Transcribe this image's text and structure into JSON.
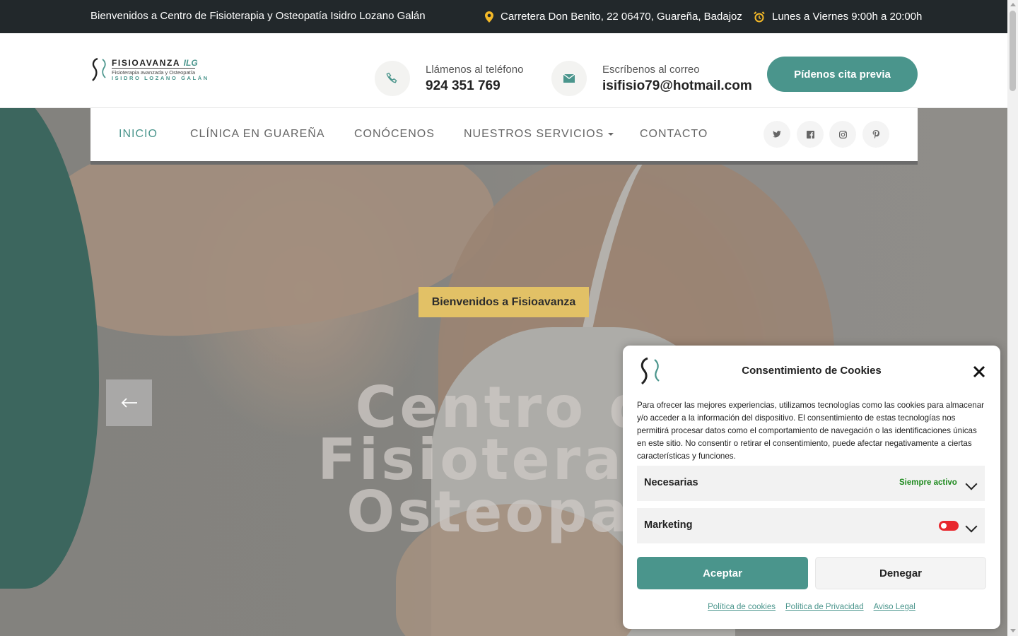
{
  "topbar": {
    "welcome": "Bienvenidos a Centro de Fisioterapia y Osteopatía Isidro Lozano Galán",
    "address": "Carretera Don Benito, 22 06470, Guareña, Badajoz",
    "hours": "Lunes a Viernes 9:00h a 20:00h",
    "icons": [
      "map-pin-icon",
      "alarm-clock-icon"
    ]
  },
  "header": {
    "logo": {
      "brand": "FISIOAVANZA",
      "brand_accent": "ILG",
      "tagline": "Fisioterapia avanzada y Osteopatía",
      "owner": "ISIDRO LOZANO GALÁN"
    },
    "phone": {
      "label": "Llámenos al teléfono",
      "value": "924 351 769"
    },
    "email": {
      "label": "Escríbenos al correo",
      "value": "isifisio79@hotmail.com"
    },
    "cta_label": "Pídenos cita previa"
  },
  "nav": {
    "items": [
      {
        "label": "INICIO",
        "active": true
      },
      {
        "label": "CLÍNICA EN GUAREÑA",
        "active": false
      },
      {
        "label": "CONÓCENOS",
        "active": false
      },
      {
        "label": "NUESTROS SERVICIOS",
        "active": false,
        "dropdown": true
      },
      {
        "label": "CONTACTO",
        "active": false
      }
    ],
    "social": [
      "twitter-icon",
      "facebook-icon",
      "instagram-icon",
      "pinterest-icon"
    ]
  },
  "hero": {
    "badge": "Bienvenidos a Fisioavanza",
    "title_lines": [
      "Centro d",
      "Fisioterapi",
      "Osteopat"
    ]
  },
  "cookie": {
    "title": "Consentimiento de Cookies",
    "text": "Para ofrecer las mejores experiencias, utilizamos tecnologías como las cookies para almacenar y/o acceder a la información del dispositivo. El consentimiento de estas tecnologías nos permitirá procesar datos como el comportamiento de navegación o las identificaciones únicas en este sitio. No consentir o retirar el consentimiento, puede afectar negativamente a ciertas características y funciones.",
    "categories": [
      {
        "name": "Necesarias",
        "status": "Siempre activo"
      },
      {
        "name": "Marketing",
        "enabled": false
      }
    ],
    "accept_label": "Aceptar",
    "deny_label": "Denegar",
    "links": [
      "Política de cookies",
      "Política de Privacidad",
      "Aviso Legal"
    ]
  },
  "colors": {
    "accent": "#4a958c",
    "topbar": "#22282b",
    "badge": "#e2c166",
    "icon_yellow": "#f4b928",
    "toggle_off": "#e8272d"
  }
}
